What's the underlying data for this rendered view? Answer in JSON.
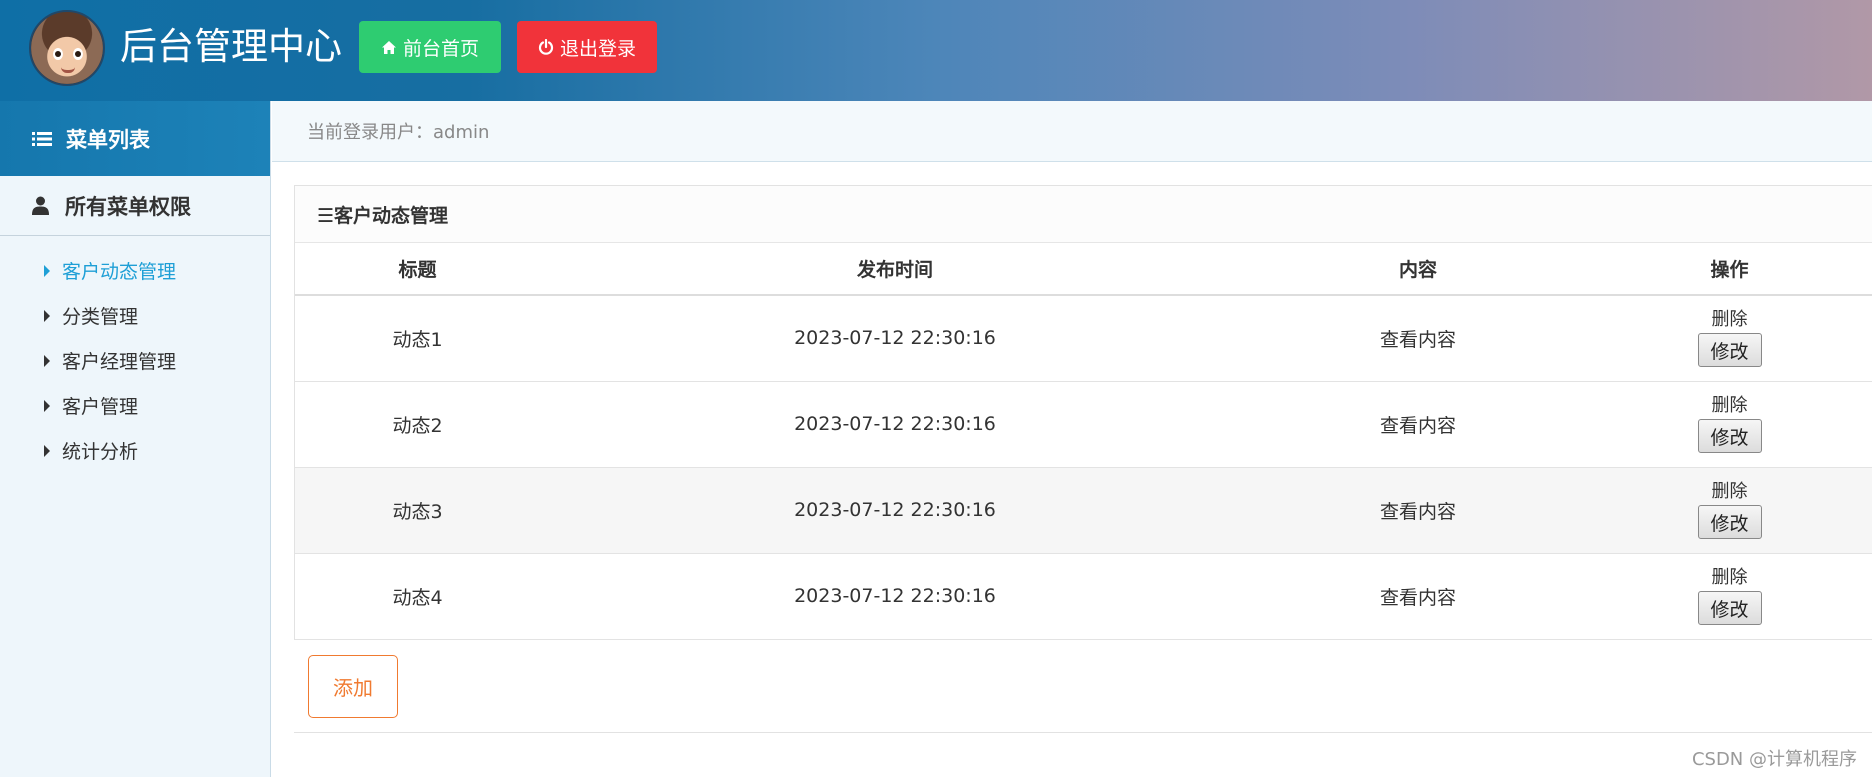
{
  "header": {
    "title": "后台管理中心",
    "home_button": "前台首页",
    "logout_button": "退出登录",
    "colors": {
      "home": "#2ecc71",
      "logout": "#f1333a"
    }
  },
  "sidebar": {
    "head_label": "菜单列表",
    "section_label": "所有菜单权限",
    "items": [
      {
        "label": "客户动态管理",
        "active": true
      },
      {
        "label": "分类管理"
      },
      {
        "label": "客户经理管理"
      },
      {
        "label": "客户管理"
      },
      {
        "label": "统计分析"
      }
    ]
  },
  "userbar": {
    "text": "当前登录用户：admin"
  },
  "panel": {
    "title": "☰客户动态管理",
    "columns": [
      "标题",
      "发布时间",
      "内容",
      "操作"
    ],
    "rows": [
      {
        "title": "动态1",
        "time": "2023-07-12 22:30:16",
        "content": "查看内容",
        "delete": "删除",
        "edit": "修改"
      },
      {
        "title": "动态2",
        "time": "2023-07-12 22:30:16",
        "content": "查看内容",
        "delete": "删除",
        "edit": "修改"
      },
      {
        "title": "动态3",
        "time": "2023-07-12 22:30:16",
        "content": "查看内容",
        "delete": "删除",
        "edit": "修改"
      },
      {
        "title": "动态4",
        "time": "2023-07-12 22:30:16",
        "content": "查看内容",
        "delete": "删除",
        "edit": "修改"
      }
    ]
  },
  "add_button": "添加",
  "watermark": "CSDN @计算机程序"
}
